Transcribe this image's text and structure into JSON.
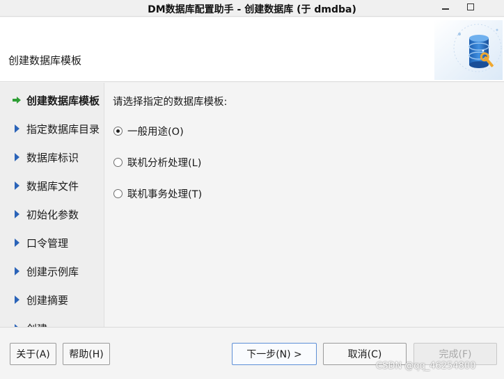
{
  "window": {
    "title": "DM数据库配置助手 - 创建数据库 (于 dmdba)"
  },
  "header": {
    "page_title": "创建数据库模板"
  },
  "sidebar": {
    "items": [
      {
        "label": "创建数据库模板",
        "active": true
      },
      {
        "label": "指定数据库目录",
        "active": false
      },
      {
        "label": "数据库标识",
        "active": false
      },
      {
        "label": "数据库文件",
        "active": false
      },
      {
        "label": "初始化参数",
        "active": false
      },
      {
        "label": "口令管理",
        "active": false
      },
      {
        "label": "创建示例库",
        "active": false
      },
      {
        "label": "创建摘要",
        "active": false
      },
      {
        "label": "创建",
        "active": false
      }
    ]
  },
  "main": {
    "prompt": "请选择指定的数据库模板:",
    "options": [
      {
        "label": "一般用途(O)",
        "checked": true
      },
      {
        "label": "联机分析处理(L)",
        "checked": false
      },
      {
        "label": "联机事务处理(T)",
        "checked": false
      }
    ]
  },
  "footer": {
    "about_label": "关于(A)",
    "help_label": "帮助(H)",
    "next_label": "下一步(N) >",
    "cancel_label": "取消(C)",
    "finish_label": "完成(F)",
    "watermark": "CSDN @qq_46254800"
  },
  "colors": {
    "arrow": "#2e9e35",
    "nav_triangle": "#2a63b8",
    "primary_border": "#5c8ed6"
  },
  "icons": {
    "active_marker": "arrow-right-icon",
    "nav_marker": "triangle-right-icon",
    "logo": "database-settings-icon"
  }
}
